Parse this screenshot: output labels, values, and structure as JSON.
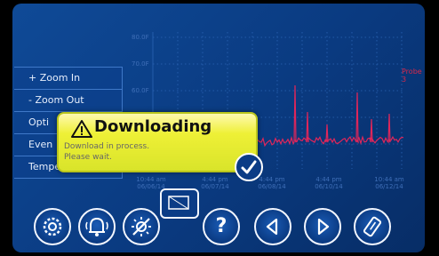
{
  "probe_label": "Probe 3",
  "menu": {
    "items": [
      "+ Zoom In",
      "- Zoom Out",
      "Opti",
      "Even",
      "Temperature Log"
    ]
  },
  "dialog": {
    "title": "Downloading",
    "line1": "Download in process.",
    "line2": "Please wait."
  },
  "toolbar": {
    "help_label": "?"
  },
  "chart_data": {
    "type": "line",
    "y_ticks": [
      "80.0F",
      "70.0F",
      "60.0F"
    ],
    "x_ticks": [
      {
        "time": "10:44 am",
        "date": "06/06/14"
      },
      {
        "time": "4:44 pm",
        "date": "06/07/14"
      },
      {
        "time": "4:44 pm",
        "date": "06/08/14"
      },
      {
        "time": "4:44 pm",
        "date": "06/10/14"
      },
      {
        "time": "10:44 am",
        "date": "06/12/14"
      }
    ],
    "series": [
      {
        "name": "Probe 3",
        "color": "#e0265a"
      }
    ],
    "grid": true
  },
  "colors": {
    "screen_bg": "#0f4a97",
    "trace": "#e0265a",
    "dialog_bg": "#eef036"
  },
  "icons": [
    "warning-icon",
    "checkmark-icon",
    "settings-gear-icon",
    "alarm-bell-icon",
    "brightness-off-icon",
    "screen-icon",
    "help-icon",
    "left-arrow-icon",
    "right-arrow-icon",
    "usb-download-icon"
  ]
}
